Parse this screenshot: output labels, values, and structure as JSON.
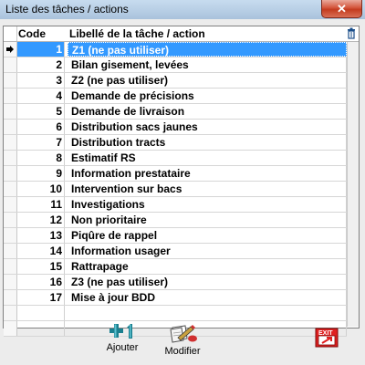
{
  "window": {
    "title": "Liste des tâches / actions",
    "close_symbol": "✕"
  },
  "grid": {
    "columns": {
      "code": "Code",
      "libelle": "Libellé de la tâche / action"
    },
    "selected_row": 0,
    "rows": [
      {
        "code": "1",
        "libelle": "Z1 (ne pas utiliser)"
      },
      {
        "code": "2",
        "libelle": "Bilan gisement, levées"
      },
      {
        "code": "3",
        "libelle": "Z2 (ne pas utiliser)"
      },
      {
        "code": "4",
        "libelle": "Demande de précisions"
      },
      {
        "code": "5",
        "libelle": "Demande de livraison"
      },
      {
        "code": "6",
        "libelle": "Distribution sacs jaunes"
      },
      {
        "code": "7",
        "libelle": "Distribution tracts"
      },
      {
        "code": "8",
        "libelle": "Estimatif RS"
      },
      {
        "code": "9",
        "libelle": "Information prestataire"
      },
      {
        "code": "10",
        "libelle": "Intervention sur bacs"
      },
      {
        "code": "11",
        "libelle": "Investigations"
      },
      {
        "code": "12",
        "libelle": "Non prioritaire"
      },
      {
        "code": "13",
        "libelle": "Piqûre de rappel"
      },
      {
        "code": "14",
        "libelle": "Information usager"
      },
      {
        "code": "15",
        "libelle": "Rattrapage"
      },
      {
        "code": "16",
        "libelle": "Z3 (ne pas utiliser)"
      },
      {
        "code": "17",
        "libelle": "Mise à jour BDD"
      },
      {
        "code": "",
        "libelle": ""
      },
      {
        "code": "",
        "libelle": ""
      }
    ]
  },
  "toolbar": {
    "add_label": "Ajouter",
    "edit_label": "Modifier",
    "exit_label": "EXIT"
  },
  "colors": {
    "selection": "#3399ff",
    "exit_red": "#e02020",
    "add_teal": "#1a7f8f"
  }
}
